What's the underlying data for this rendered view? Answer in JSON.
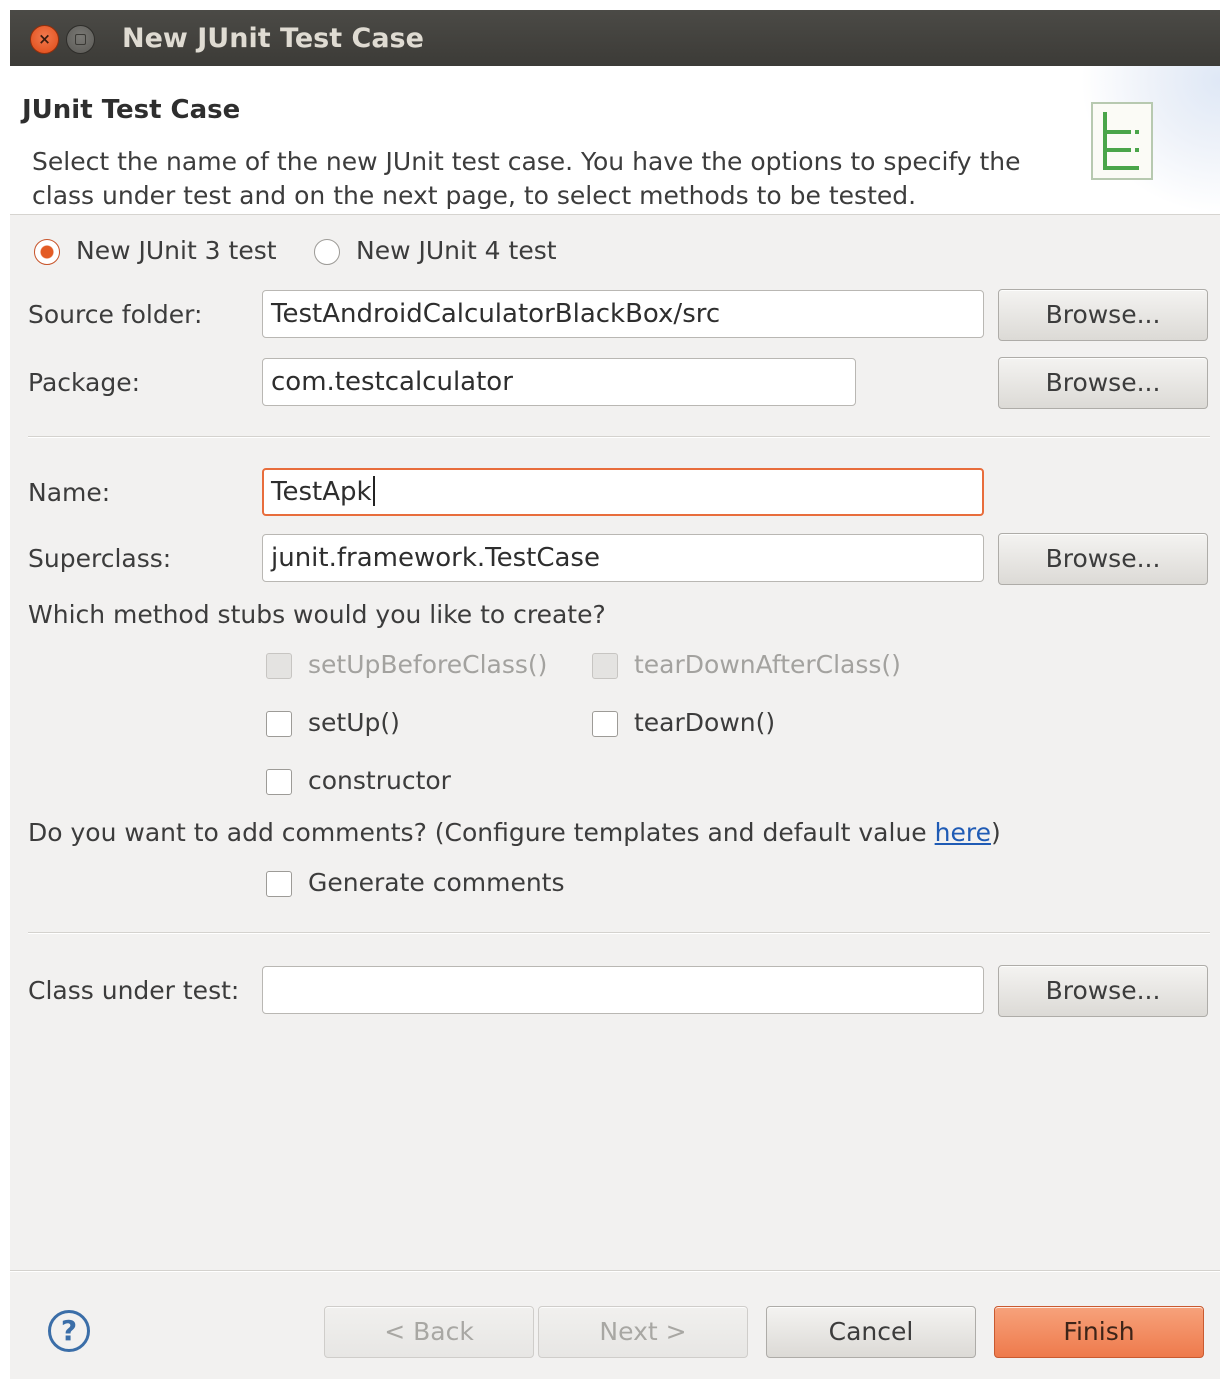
{
  "window": {
    "title": "New JUnit Test Case",
    "close_glyph": "×"
  },
  "header": {
    "title": "JUnit Test Case",
    "description": "Select the name of the new JUnit test case. You have the options to specify the class under test and on the next page, to select methods to be tested.",
    "icon": "junit-wizard-icon"
  },
  "version": {
    "options": [
      {
        "label": "New JUnit 3 test",
        "selected": true
      },
      {
        "label": "New JUnit 4 test",
        "selected": false
      }
    ]
  },
  "source_folder": {
    "label": "Source folder:",
    "value": "TestAndroidCalculatorBlackBox/src",
    "browse": "Browse..."
  },
  "package": {
    "label": "Package:",
    "value": "com.testcalculator",
    "browse": "Browse..."
  },
  "name": {
    "label": "Name:",
    "value": "TestApk"
  },
  "superclass": {
    "label": "Superclass:",
    "value": "junit.framework.TestCase",
    "browse": "Browse..."
  },
  "stubs": {
    "question": "Which method stubs would you like to create?",
    "items": [
      {
        "label": "setUpBeforeClass()",
        "checked": false,
        "enabled": false
      },
      {
        "label": "tearDownAfterClass()",
        "checked": false,
        "enabled": false
      },
      {
        "label": "setUp()",
        "checked": false,
        "enabled": true
      },
      {
        "label": "tearDown()",
        "checked": false,
        "enabled": true
      },
      {
        "label": "constructor",
        "checked": false,
        "enabled": true
      }
    ]
  },
  "comments": {
    "question_prefix": "Do you want to add comments? (Configure templates and default value ",
    "link": "here",
    "question_suffix": ")",
    "generate_label": "Generate comments",
    "generate_checked": false
  },
  "class_under_test": {
    "label": "Class under test:",
    "value": "",
    "browse": "Browse..."
  },
  "footer": {
    "help_glyph": "?",
    "back": "< Back",
    "next": "Next >",
    "cancel": "Cancel",
    "finish": "Finish"
  },
  "colors": {
    "accent": "#e86d3c",
    "titlebar": "#3c3b37",
    "link": "#1f5bb5"
  }
}
